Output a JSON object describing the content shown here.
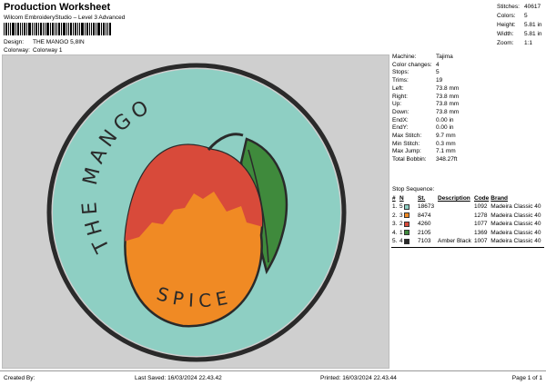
{
  "header": {
    "title": "Production Worksheet",
    "subtitle": "Wilcom EmbroideryStudio – Level 3 Advanced"
  },
  "design_info": [
    {
      "label": "Design:",
      "value": "THE MANGO 5,8IN"
    },
    {
      "label": "Colorway:",
      "value": "Colorway 1"
    }
  ],
  "stats": [
    {
      "label": "Stitches:",
      "value": "40617"
    },
    {
      "label": "Colors:",
      "value": "5"
    },
    {
      "label": "Height:",
      "value": "5.81 in"
    },
    {
      "label": "Width:",
      "value": "5.81 in"
    },
    {
      "label": "Zoom:",
      "value": "1:1"
    }
  ],
  "details": [
    {
      "label": "Machine:",
      "value": "Tajima"
    },
    {
      "label": "Color changes:",
      "value": "4"
    },
    {
      "label": "Stops:",
      "value": "5"
    },
    {
      "label": "Trims:",
      "value": "19"
    },
    {
      "label": "Left:",
      "value": "73.8 mm"
    },
    {
      "label": "Right:",
      "value": "73.8 mm"
    },
    {
      "label": "Up:",
      "value": "73.8 mm"
    },
    {
      "label": "Down:",
      "value": "73.8 mm"
    },
    {
      "label": "EndX:",
      "value": "0.00 in"
    },
    {
      "label": "EndY:",
      "value": "0.00 in"
    },
    {
      "label": "Max Stitch:",
      "value": "9.7 mm"
    },
    {
      "label": "Min Stitch:",
      "value": "0.3 mm"
    },
    {
      "label": "Max Jump:",
      "value": "7.1 mm"
    },
    {
      "label": "Total Bobbin:",
      "value": "348.27ft"
    }
  ],
  "stop_sequence": {
    "title": "Stop Sequence:",
    "columns": [
      "#",
      "N",
      "St.",
      "Description",
      "Code",
      "Brand"
    ],
    "rows": [
      {
        "idx": "1.",
        "n": "5",
        "color": "#8ecfc3",
        "st": "18673",
        "desc": "",
        "code": "1092",
        "brand": "Madeira Classic 40"
      },
      {
        "idx": "2.",
        "n": "3",
        "color": "#f08a24",
        "st": "8474",
        "desc": "",
        "code": "1278",
        "brand": "Madeira Classic 40"
      },
      {
        "idx": "3.",
        "n": "2",
        "color": "#d84a3a",
        "st": "4260",
        "desc": "",
        "code": "1077",
        "brand": "Madeira Classic 40"
      },
      {
        "idx": "4.",
        "n": "1",
        "color": "#3f8a3c",
        "st": "2105",
        "desc": "",
        "code": "1369",
        "brand": "Madeira Classic 40"
      },
      {
        "idx": "5.",
        "n": "4",
        "color": "#2a2a2a",
        "st": "7103",
        "desc": "Amber Black",
        "code": "1007",
        "brand": "Madeira Classic 40"
      }
    ]
  },
  "artwork": {
    "text_top": "THE MANGO",
    "text_bottom": "SPICE",
    "colors": {
      "background": "#8ecfc3",
      "outline": "#2a2a2a",
      "orange": "#f08a24",
      "red": "#d84a3a",
      "leaf": "#3f8a3c"
    }
  },
  "footer": {
    "created_by": "Created By:",
    "last_saved": "Last Saved: 16/03/2024 22.43.42",
    "printed": "Printed: 16/03/2024 22.43.44",
    "page": "Page 1 of 1"
  }
}
